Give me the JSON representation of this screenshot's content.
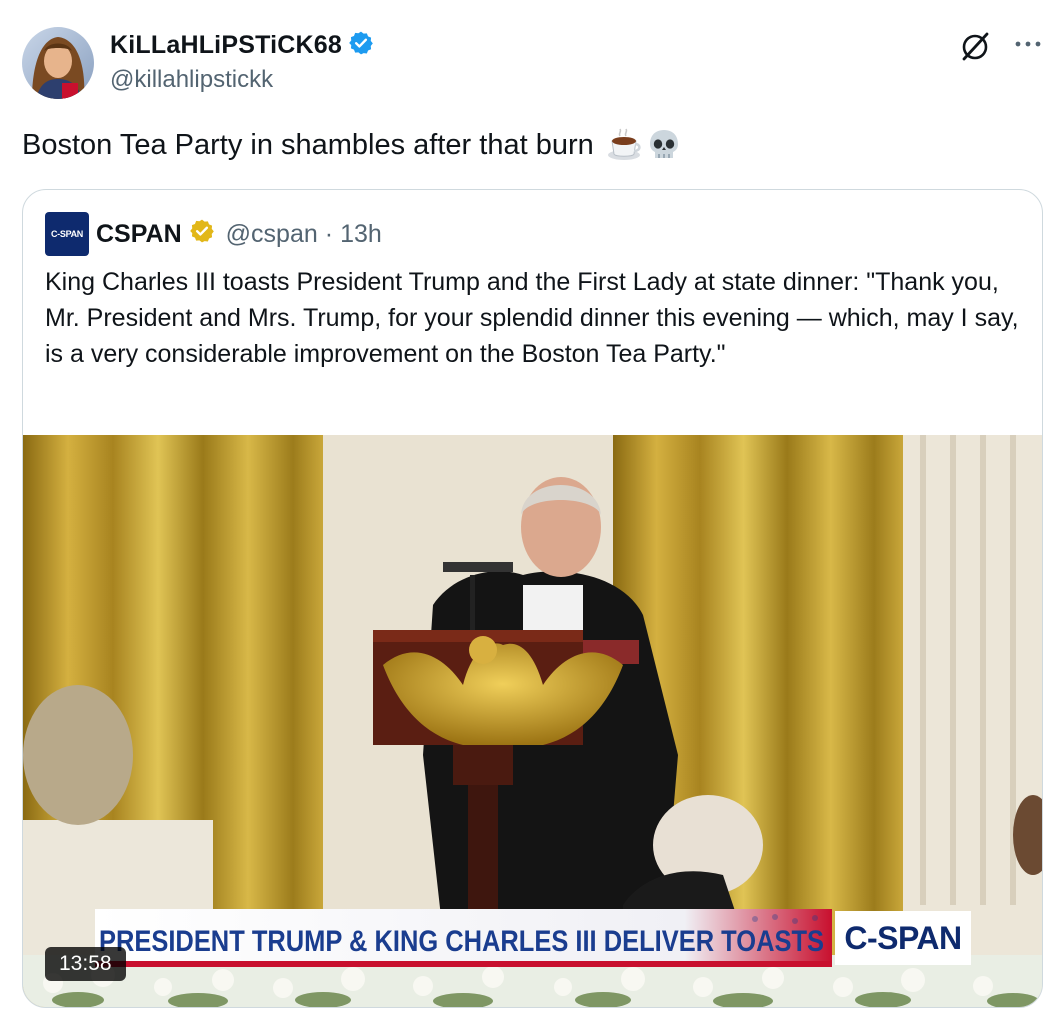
{
  "author": {
    "display_name": "KiLLaHLiPSTiCK68",
    "handle": "@killahlipstickk",
    "verified": true
  },
  "post": {
    "text": "Boston Tea Party in shambles after that burn",
    "emojis": [
      "hot-beverage-emoji",
      "skull-emoji"
    ]
  },
  "quoted": {
    "logo_text": "C-SPAN",
    "name": "CSPAN",
    "handle": "@cspan",
    "separator": "·",
    "time": "13h",
    "text": "King Charles III toasts President Trump and the First Lady at state dinner: \"Thank you, Mr. President and Mrs. Trump, for your splendid dinner this evening — which, may I say, is a very considerable improvement on the Boston Tea Party.\"",
    "video": {
      "duration": "13:58",
      "chyron": "PRESIDENT TRUMP & KING CHARLES III DELIVER TOASTS",
      "bug": "C-SPAN"
    }
  },
  "colors": {
    "verified_blue": "#1d9bf0",
    "gold_badge": "#e2b719",
    "secondary_text": "#536471",
    "border": "#cfd9de"
  }
}
